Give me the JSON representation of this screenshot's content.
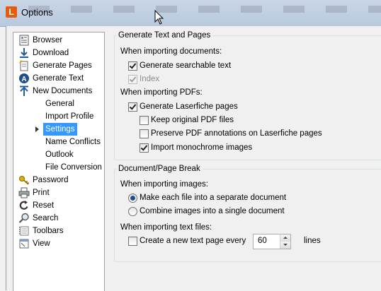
{
  "window": {
    "title": "Options",
    "app_icon_letter": "L"
  },
  "nav": {
    "items": [
      {
        "label": "Browser",
        "icon": "browser-icon"
      },
      {
        "label": "Download",
        "icon": "download-icon"
      },
      {
        "label": "Generate Pages",
        "icon": "generate-pages-icon"
      },
      {
        "label": "Generate Text",
        "icon": "generate-text-icon"
      },
      {
        "label": "New Documents",
        "icon": "new-documents-icon"
      },
      {
        "label": "Password",
        "icon": "key-icon"
      },
      {
        "label": "Print",
        "icon": "printer-icon"
      },
      {
        "label": "Reset",
        "icon": "reset-icon"
      },
      {
        "label": "Search",
        "icon": "search-icon"
      },
      {
        "label": "Toolbars",
        "icon": "toolbars-icon"
      },
      {
        "label": "View",
        "icon": "view-icon"
      }
    ],
    "subitems": [
      {
        "label": "General"
      },
      {
        "label": "Import Profile"
      },
      {
        "label": "Settings",
        "selected": true
      },
      {
        "label": "Name Conflicts"
      },
      {
        "label": "Outlook"
      },
      {
        "label": "File Conversion"
      }
    ]
  },
  "gen_group": {
    "title": "Generate Text and Pages",
    "docs_heading": "When importing documents:",
    "searchable_text": {
      "label": "Generate searchable text",
      "checked": true
    },
    "index": {
      "label": "Index",
      "checked": true,
      "disabled": true
    },
    "pdf_heading": "When importing PDFs:",
    "laserfiche_pages": {
      "label": "Generate Laserfiche pages",
      "checked": true
    },
    "keep_pdf": {
      "label": "Keep original PDF files",
      "checked": false
    },
    "preserve_annotations": {
      "label": "Preserve PDF annotations on Laserfiche pages",
      "checked": false
    },
    "monochrome": {
      "label": "Import monochrome images",
      "checked": true
    }
  },
  "break_group": {
    "title": "Document/Page Break",
    "images_heading": "When importing images:",
    "separate_docs": {
      "label": "Make each file into a separate document",
      "selected": true
    },
    "combine_images": {
      "label": "Combine images into a single document",
      "selected": false
    },
    "text_heading": "When importing text files:",
    "new_text_page": {
      "label": "Create a new text page every",
      "checked": false
    },
    "lines_value": "60",
    "lines_unit": "lines"
  },
  "colors": {
    "selection": "#3399ff",
    "title_bar": "#c9d6e6",
    "brand": "#e85a0c"
  }
}
